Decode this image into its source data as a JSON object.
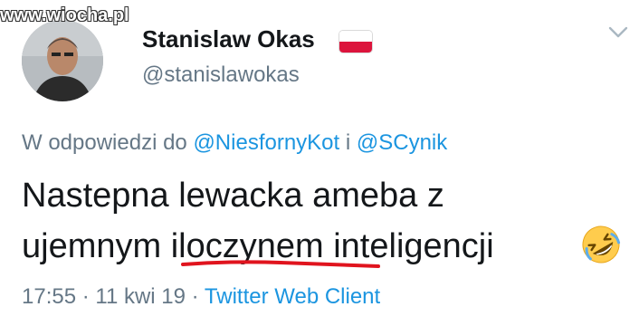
{
  "watermark": "www.wiocha.pl",
  "author": {
    "display_name": "Stanislaw Okas",
    "handle": "@stanislawokas",
    "flag_icon": "poland-flag-icon"
  },
  "reply": {
    "prefix": "W odpowiedzi do ",
    "mention1": "@NiesfornyKot",
    "connector": " i ",
    "mention2": "@SCynik"
  },
  "tweet": {
    "line1": "Nastepna lewacka ameba z",
    "line2_part1": "ujemnym ",
    "line2_underlined": "iloczynem",
    "line2_part2": " inteligencji",
    "emoji": "rolling-on-the-floor-laughing-emoji"
  },
  "meta": {
    "time": "17:55",
    "sep1": " · ",
    "date": "11 kwi 19",
    "sep2": " · ",
    "client": "Twitter Web Client"
  },
  "colors": {
    "link": "#1b95e0",
    "muted": "#657786",
    "text": "#14171a",
    "underline": "#e0141e"
  }
}
